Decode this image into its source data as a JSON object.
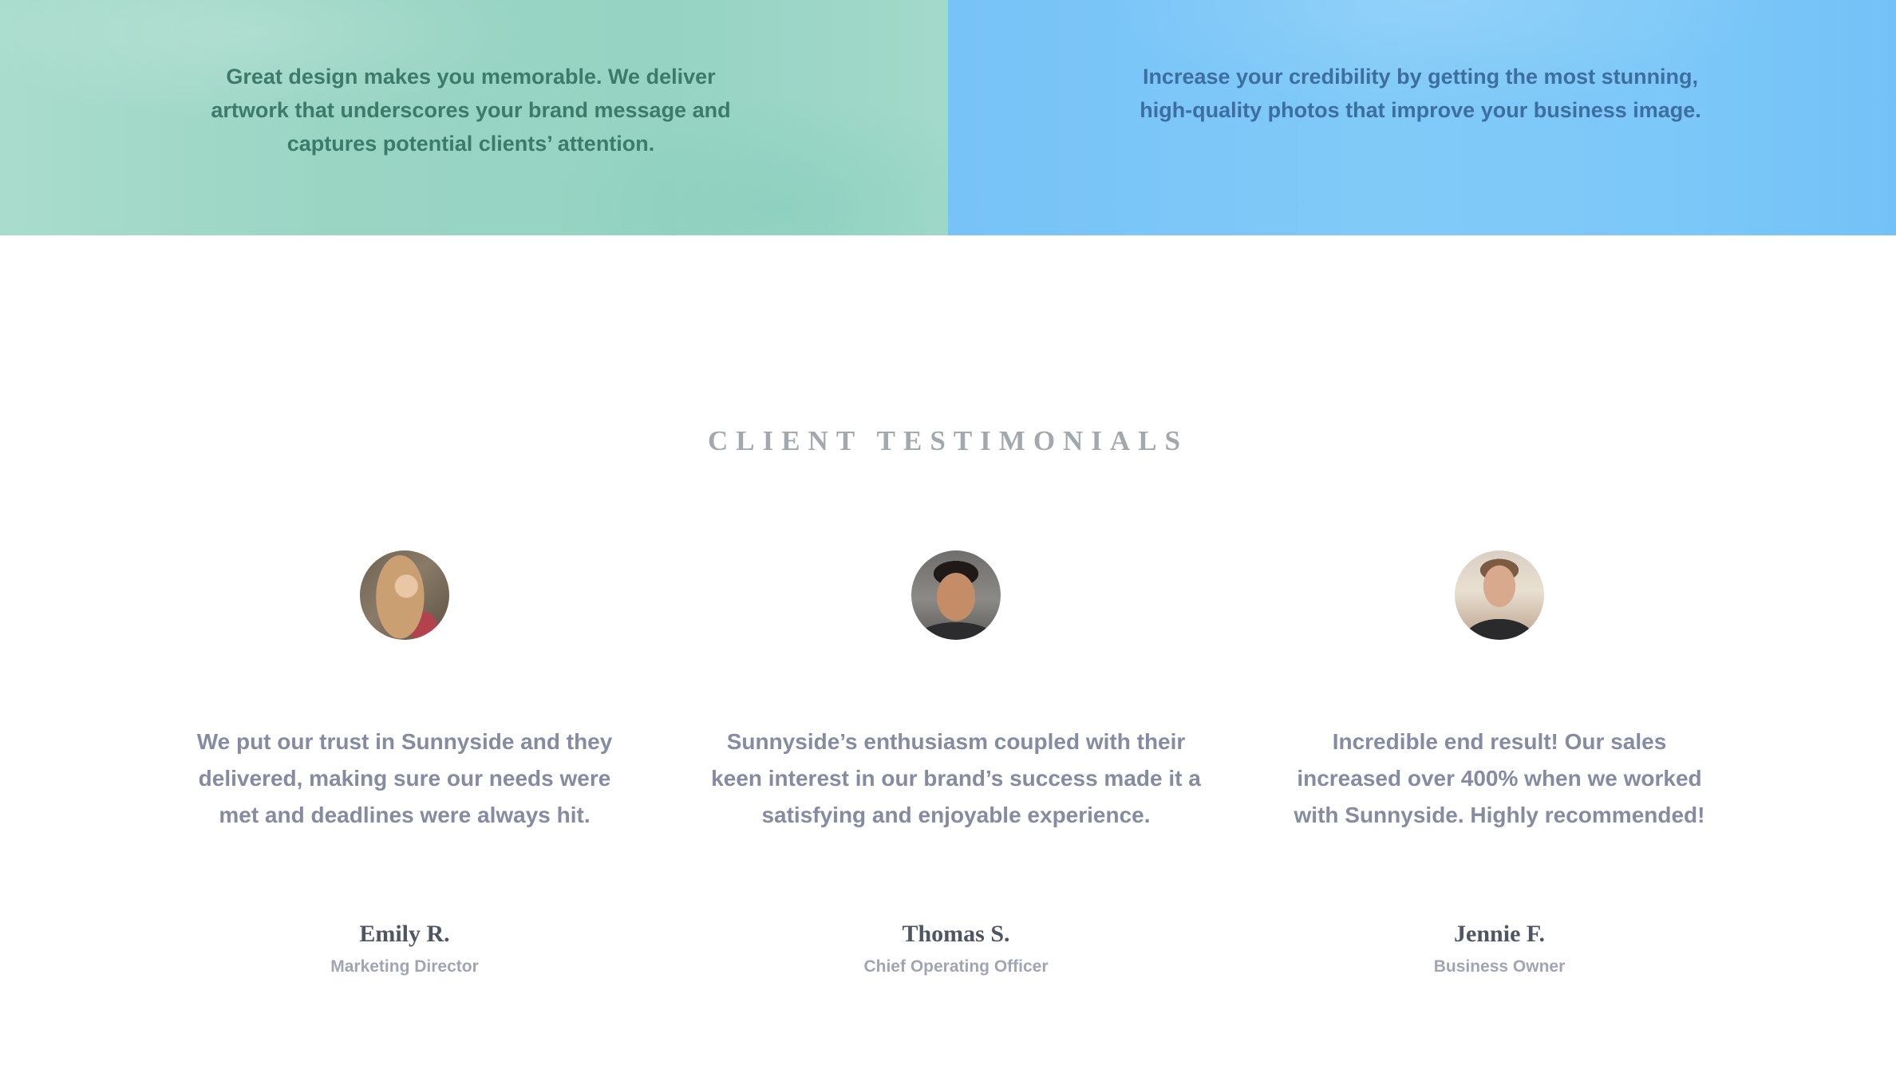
{
  "services": {
    "graphic_design": {
      "description": "Great design makes you memorable. We deliver artwork that underscores your brand message and captures potential clients’ attention."
    },
    "photography": {
      "description": "Increase your credibility by getting the most stunning, high-quality photos that improve your business image."
    }
  },
  "testimonials": {
    "heading": "CLIENT TESTIMONIALS",
    "items": [
      {
        "quote": "We put our trust in Sunnyside and they delivered, making sure our needs were met and deadlines were always hit.",
        "name": "Emily R.",
        "role": "Marketing Director"
      },
      {
        "quote": "Sunnyside’s enthusiasm coupled with their keen interest in our brand’s success made it a satisfying and enjoyable experience.",
        "name": "Thomas S.",
        "role": "Chief Operating Officer"
      },
      {
        "quote": "Incredible end result! Our sales increased over 400% when we worked with Sunnyside. Highly recommended!",
        "name": "Jennie F.",
        "role": "Business Owner"
      }
    ]
  },
  "colors": {
    "design_panel": "#9ad5c4",
    "photo_panel": "#7cc8f8",
    "heading": "#a1a9ae",
    "quote_text": "#858ba0",
    "name_text": "#4f5663"
  }
}
